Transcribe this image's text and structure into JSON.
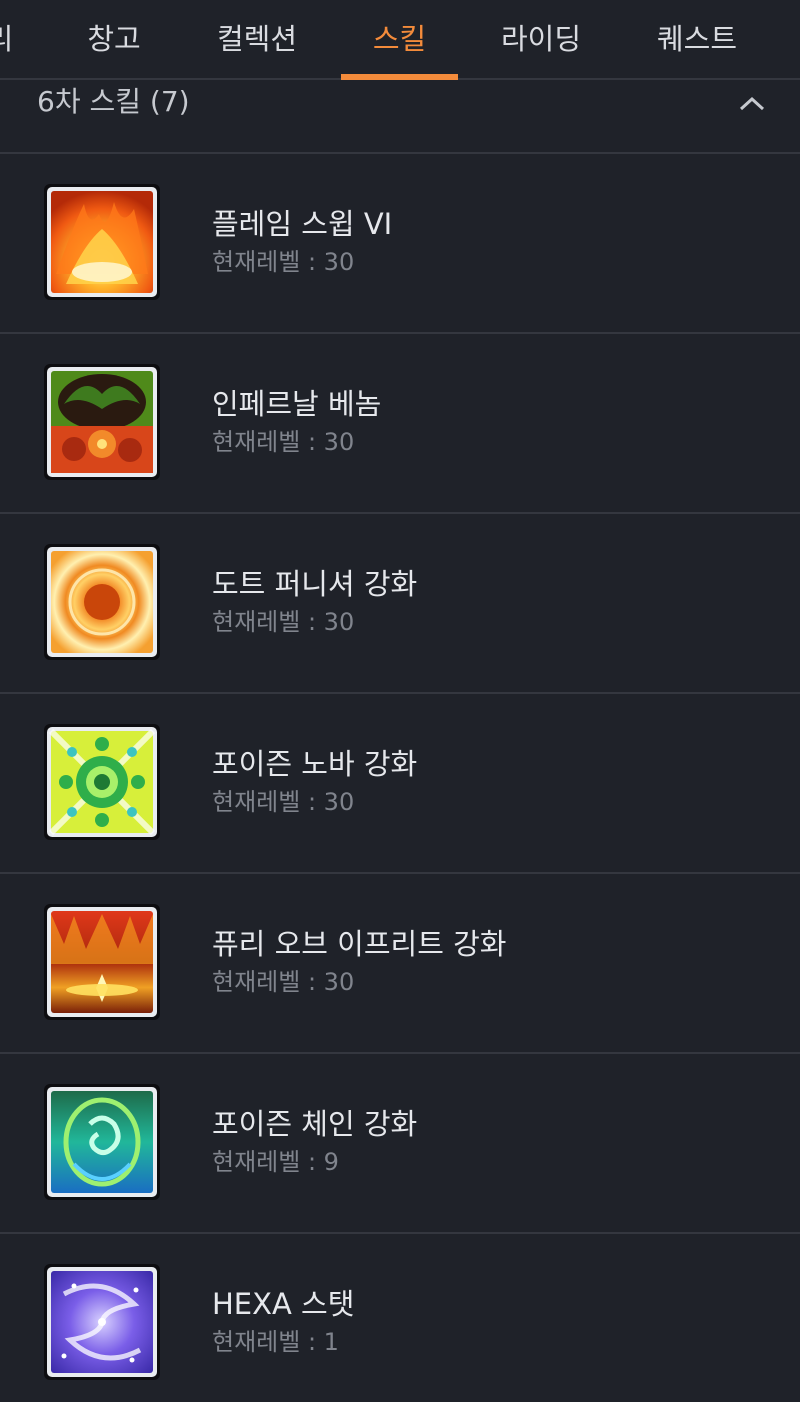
{
  "tabs": [
    {
      "label": "리",
      "active": false
    },
    {
      "label": "창고",
      "active": false
    },
    {
      "label": "컬렉션",
      "active": false
    },
    {
      "label": "스킬",
      "active": true
    },
    {
      "label": "라이딩",
      "active": false
    },
    {
      "label": "퀘스트",
      "active": false
    }
  ],
  "colors": {
    "background": "#1f2229",
    "accent": "#f38b3b",
    "divider": "#34373f",
    "primary_text": "#e6e8ec",
    "secondary_text": "#80848d"
  },
  "section": {
    "title": "6차 스킬 (7)",
    "collapse_icon": "chevron-up-icon"
  },
  "level_label": "현재레벨 : ",
  "skills": [
    {
      "name": "플레임 스윕 VI",
      "level": "30",
      "icon": "flame-sweep-icon"
    },
    {
      "name": "인페르날 베놈",
      "level": "30",
      "icon": "infernal-venom-icon"
    },
    {
      "name": "도트 퍼니셔 강화",
      "level": "30",
      "icon": "dot-punisher-icon"
    },
    {
      "name": "포이즌 노바 강화",
      "level": "30",
      "icon": "poison-nova-icon"
    },
    {
      "name": "퓨리 오브 이프리트 강화",
      "level": "30",
      "icon": "fury-of-ifrit-icon"
    },
    {
      "name": "포이즌 체인 강화",
      "level": "9",
      "icon": "poison-chain-icon"
    },
    {
      "name": "HEXA 스탯",
      "level": "1",
      "icon": "hexa-stat-icon"
    }
  ]
}
